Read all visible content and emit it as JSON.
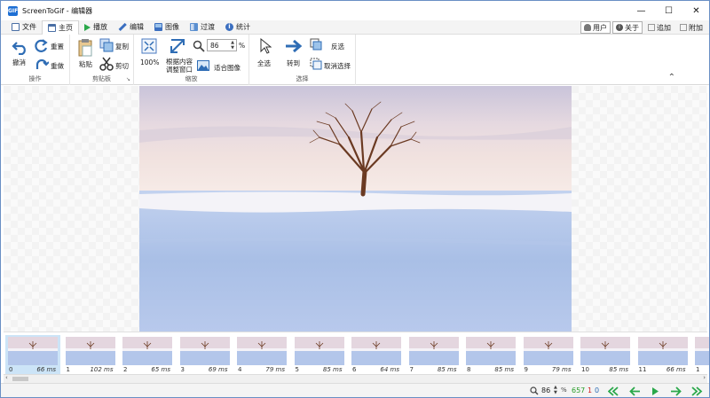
{
  "window": {
    "title": "ScreenToGif - 编辑器",
    "app_icon_text": "GIF",
    "minimize": "—",
    "maximize": "☐",
    "close": "✕"
  },
  "tabs": [
    {
      "label": "文件",
      "active": false,
      "icon": "save-icon",
      "color": "#4a6fa5"
    },
    {
      "label": "主页",
      "active": true,
      "icon": "home-icon",
      "color": "#4a6fa5"
    },
    {
      "label": "播放",
      "active": false,
      "icon": "play-icon",
      "color": "#2aa84a"
    },
    {
      "label": "编辑",
      "active": false,
      "icon": "pencil-icon",
      "color": "#3b6fc0"
    },
    {
      "label": "图像",
      "active": false,
      "icon": "image-icon",
      "color": "#3b6fc0"
    },
    {
      "label": "过渡",
      "active": false,
      "icon": "transition-icon",
      "color": "#5a8fd0"
    },
    {
      "label": "统计",
      "active": false,
      "icon": "info-icon",
      "color": "#3b6fc0"
    }
  ],
  "top_right": {
    "user": "用户",
    "about": "关于",
    "add": "追加",
    "attach": "附加"
  },
  "ribbon": {
    "undo": "撤消",
    "redo": "重置",
    "reset": "重做",
    "group_actions": "操作",
    "paste": "粘贴",
    "copy": "复制",
    "cut": "剪切",
    "group_clipboard": "剪贴板",
    "zoom100": "100%",
    "fit_content": "根据内容",
    "fit_window": "调整窗口",
    "zoom_value": "86",
    "zoom_unit": "%",
    "fit_image": "适合图像",
    "group_zoom": "缩放",
    "select_all": "全选",
    "goto": "转到",
    "invert": "反选",
    "deselect": "取消选择",
    "group_select": "选择"
  },
  "frames": [
    {
      "num": "0",
      "ms": "66 ms",
      "selected": true
    },
    {
      "num": "1",
      "ms": "102 ms",
      "selected": false
    },
    {
      "num": "2",
      "ms": "65 ms",
      "selected": false
    },
    {
      "num": "3",
      "ms": "69 ms",
      "selected": false
    },
    {
      "num": "4",
      "ms": "79 ms",
      "selected": false
    },
    {
      "num": "5",
      "ms": "85 ms",
      "selected": false
    },
    {
      "num": "6",
      "ms": "64 ms",
      "selected": false
    },
    {
      "num": "7",
      "ms": "85 ms",
      "selected": false
    },
    {
      "num": "8",
      "ms": "85 ms",
      "selected": false
    },
    {
      "num": "9",
      "ms": "79 ms",
      "selected": false
    },
    {
      "num": "10",
      "ms": "85 ms",
      "selected": false
    },
    {
      "num": "11",
      "ms": "66 ms",
      "selected": false
    },
    {
      "num": "1",
      "ms": "",
      "selected": false
    }
  ],
  "status": {
    "zoom": "86",
    "zoom_unit": "%",
    "frame_count": "657",
    "selected_count": "1",
    "frame_index": "0"
  },
  "colors": {
    "accent": "#1e6fd4",
    "arrow_blue": "#2f6db5",
    "arrow_green": "#2aa84a",
    "count_green": "#2a9d2a",
    "count_red": "#d02020"
  }
}
